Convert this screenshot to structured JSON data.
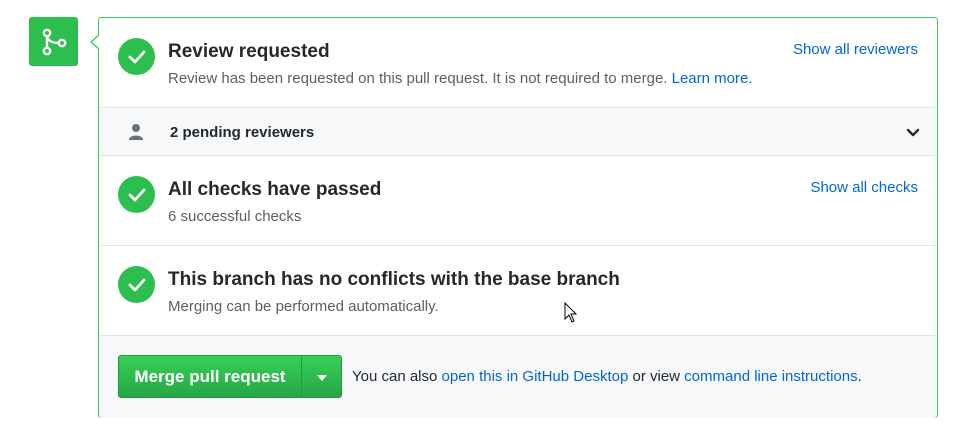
{
  "icons": {
    "merge": "git-merge-icon",
    "check": "check-icon",
    "person": "person-icon",
    "chevron": "chevron-down-icon",
    "dropdown": "triangle-down-icon"
  },
  "colors": {
    "success": "#2cbe4e",
    "border": "#34d058",
    "link": "#0366d6"
  },
  "review": {
    "title": "Review requested",
    "desc": "Review has been requested on this pull request. It is not required to merge.",
    "learn_more": "Learn more.",
    "show_all": "Show all reviewers"
  },
  "pending": {
    "label": "2 pending reviewers"
  },
  "checks": {
    "title": "All checks have passed",
    "desc": "6 successful checks",
    "show_all": "Show all checks"
  },
  "conflicts": {
    "title": "This branch has no conflicts with the base branch",
    "desc": "Merging can be performed automatically."
  },
  "merge": {
    "button_label": "Merge pull request",
    "note_prefix": "You can also",
    "desktop_link": "open this in GitHub Desktop",
    "note_middle": "or view",
    "cli_link": "command line instructions",
    "note_suffix": "."
  }
}
